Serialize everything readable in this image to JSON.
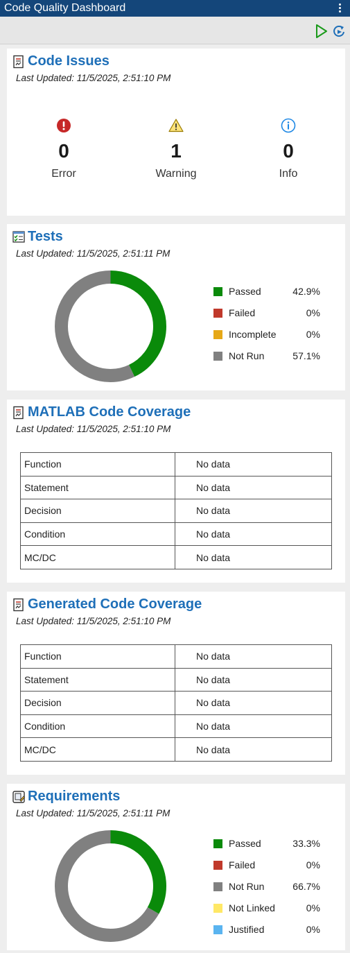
{
  "app": {
    "title": "Code Quality Dashboard"
  },
  "toolbar": {
    "buttons": [
      {
        "icon": "run-icon"
      },
      {
        "icon": "refresh-icon"
      }
    ]
  },
  "code_issues": {
    "title": "Code Issues",
    "last_updated": "Last Updated: 11/5/2025, 2:51:10 PM",
    "items": [
      {
        "icon": "error-icon",
        "count": "0",
        "label": "Error",
        "color": "#c0392b"
      },
      {
        "icon": "warning-icon",
        "count": "1",
        "label": "Warning",
        "color": "#d4a017"
      },
      {
        "icon": "info-icon",
        "count": "0",
        "label": "Info",
        "color": "#1e88e5"
      }
    ]
  },
  "tests": {
    "title": "Tests",
    "last_updated": "Last Updated: 11/5/2025, 2:51:11 PM",
    "legend": [
      {
        "label": "Passed",
        "value": "42.9%",
        "pct": 42.9,
        "color": "#0a8a0a"
      },
      {
        "label": "Failed",
        "value": "0%",
        "pct": 0,
        "color": "#c0392b"
      },
      {
        "label": "Incomplete",
        "value": "0%",
        "pct": 0,
        "color": "#e6a817"
      },
      {
        "label": "Not Run",
        "value": "57.1%",
        "pct": 57.1,
        "color": "#808080"
      }
    ]
  },
  "matlab_coverage": {
    "title": "MATLAB Code Coverage",
    "last_updated": "Last Updated: 11/5/2025, 2:51:10 PM",
    "rows": [
      {
        "metric": "Function",
        "value": "No data"
      },
      {
        "metric": "Statement",
        "value": "No data"
      },
      {
        "metric": "Decision",
        "value": "No data"
      },
      {
        "metric": "Condition",
        "value": "No data"
      },
      {
        "metric": "MC/DC",
        "value": "No data"
      }
    ]
  },
  "generated_coverage": {
    "title": "Generated Code Coverage",
    "last_updated": "Last Updated: 11/5/2025, 2:51:10 PM",
    "rows": [
      {
        "metric": "Function",
        "value": "No data"
      },
      {
        "metric": "Statement",
        "value": "No data"
      },
      {
        "metric": "Decision",
        "value": "No data"
      },
      {
        "metric": "Condition",
        "value": "No data"
      },
      {
        "metric": "MC/DC",
        "value": "No data"
      }
    ]
  },
  "requirements": {
    "title": "Requirements",
    "last_updated": "Last Updated: 11/5/2025, 2:51:11 PM",
    "legend": [
      {
        "label": "Passed",
        "value": "33.3%",
        "pct": 33.3,
        "color": "#0a8a0a"
      },
      {
        "label": "Failed",
        "value": "0%",
        "pct": 0,
        "color": "#c0392b"
      },
      {
        "label": "Not Run",
        "value": "66.7%",
        "pct": 66.7,
        "color": "#808080"
      },
      {
        "label": "Not Linked",
        "value": "0%",
        "pct": 0,
        "color": "#ffe866"
      },
      {
        "label": "Justified",
        "value": "0%",
        "pct": 0,
        "color": "#5ab4f0"
      }
    ]
  }
}
